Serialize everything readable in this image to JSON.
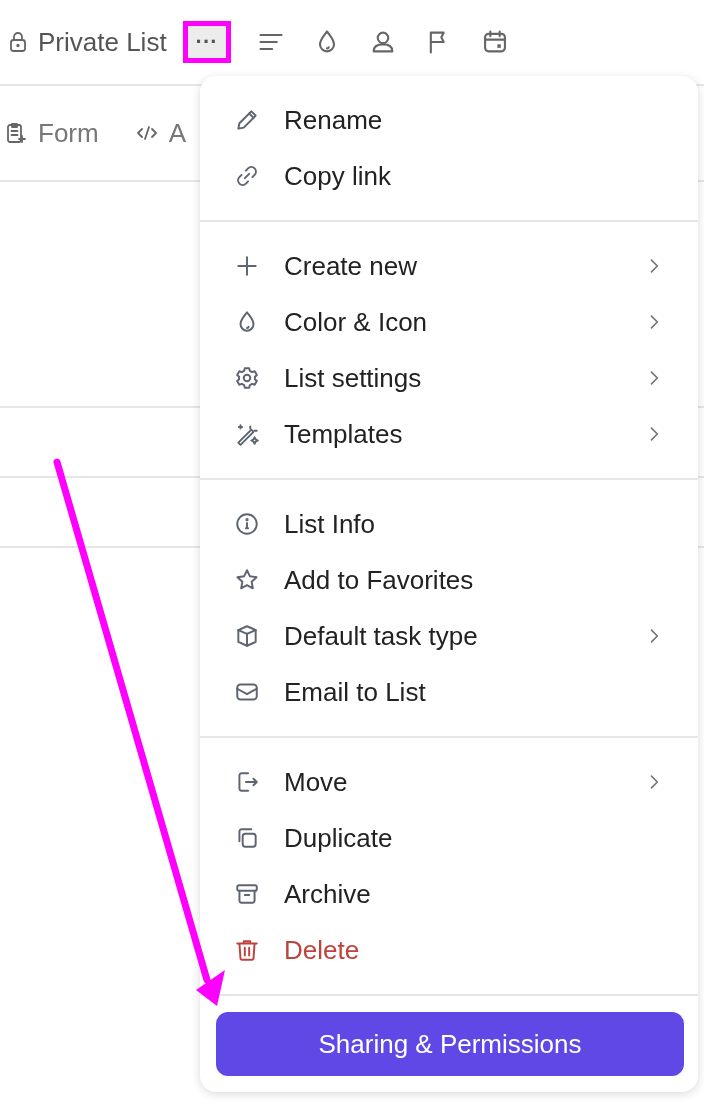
{
  "header": {
    "title": "Private List",
    "more_button": {
      "label": "···",
      "highlighted": true
    }
  },
  "views": [
    {
      "label": "Form"
    },
    {
      "label": "A"
    }
  ],
  "menu": {
    "sections": [
      [
        {
          "label": "Rename",
          "submenu": false,
          "danger": false
        },
        {
          "label": "Copy link",
          "submenu": false,
          "danger": false
        }
      ],
      [
        {
          "label": "Create new",
          "submenu": true,
          "danger": false
        },
        {
          "label": "Color & Icon",
          "submenu": true,
          "danger": false
        },
        {
          "label": "List settings",
          "submenu": true,
          "danger": false
        },
        {
          "label": "Templates",
          "submenu": true,
          "danger": false
        }
      ],
      [
        {
          "label": "List Info",
          "submenu": false,
          "danger": false
        },
        {
          "label": "Add to Favorites",
          "submenu": false,
          "danger": false
        },
        {
          "label": "Default task type",
          "submenu": true,
          "danger": false
        },
        {
          "label": "Email to List",
          "submenu": false,
          "danger": false
        }
      ],
      [
        {
          "label": "Move",
          "submenu": true,
          "danger": false
        },
        {
          "label": "Duplicate",
          "submenu": false,
          "danger": false
        },
        {
          "label": "Archive",
          "submenu": false,
          "danger": false
        },
        {
          "label": "Delete",
          "submenu": false,
          "danger": true
        }
      ]
    ],
    "primary_button": "Sharing & Permissions"
  },
  "annotation": {
    "kind": "arrow"
  }
}
